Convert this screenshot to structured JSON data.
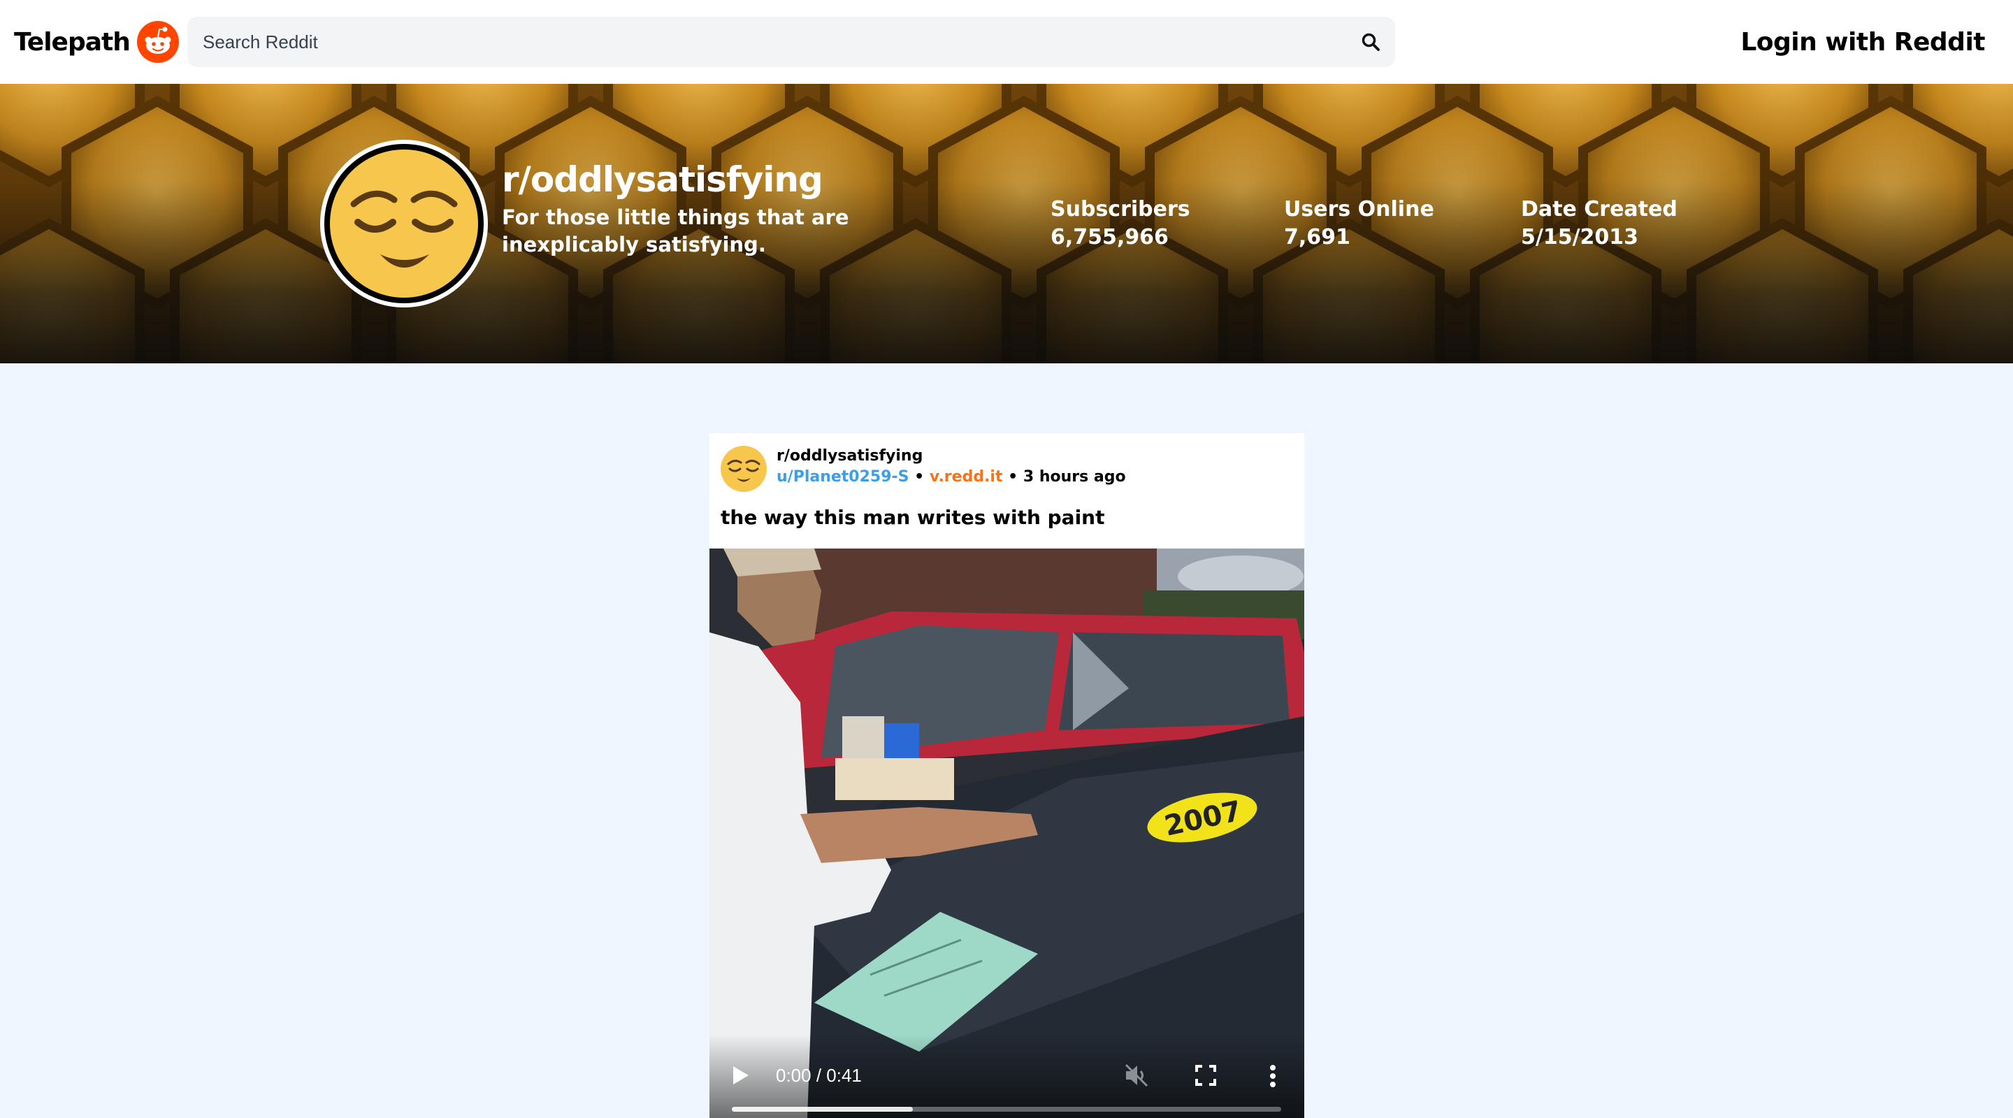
{
  "header": {
    "brand": "Telepath",
    "search_placeholder": "Search Reddit",
    "login_label": "Login with Reddit"
  },
  "subreddit": {
    "name": "r/oddlysatisfying",
    "description": "For those little things that are inexplicably satisfying.",
    "stats": [
      {
        "label": "Subscribers",
        "value": "6,755,966"
      },
      {
        "label": "Users Online",
        "value": "7,691"
      },
      {
        "label": "Date Created",
        "value": "5/15/2013"
      }
    ]
  },
  "post": {
    "subreddit": "r/oddlysatisfying",
    "author": "u/Planet0259-S",
    "separator": " • ",
    "domain": "v.redd.it",
    "age": "3 hours ago",
    "title": "the way this man writes with paint",
    "video": {
      "time": "0:00 / 0:41",
      "buffered_fraction": 0.33,
      "muted": true
    }
  },
  "colors": {
    "background": "#eff6ff",
    "author_link": "#3b9ee8",
    "domain_link": "#f97316",
    "reddit_orange": "#ff4500"
  },
  "icons": [
    "reddit-logo-icon",
    "search-icon",
    "play-icon",
    "mute-icon",
    "fullscreen-icon",
    "more-options-icon"
  ]
}
